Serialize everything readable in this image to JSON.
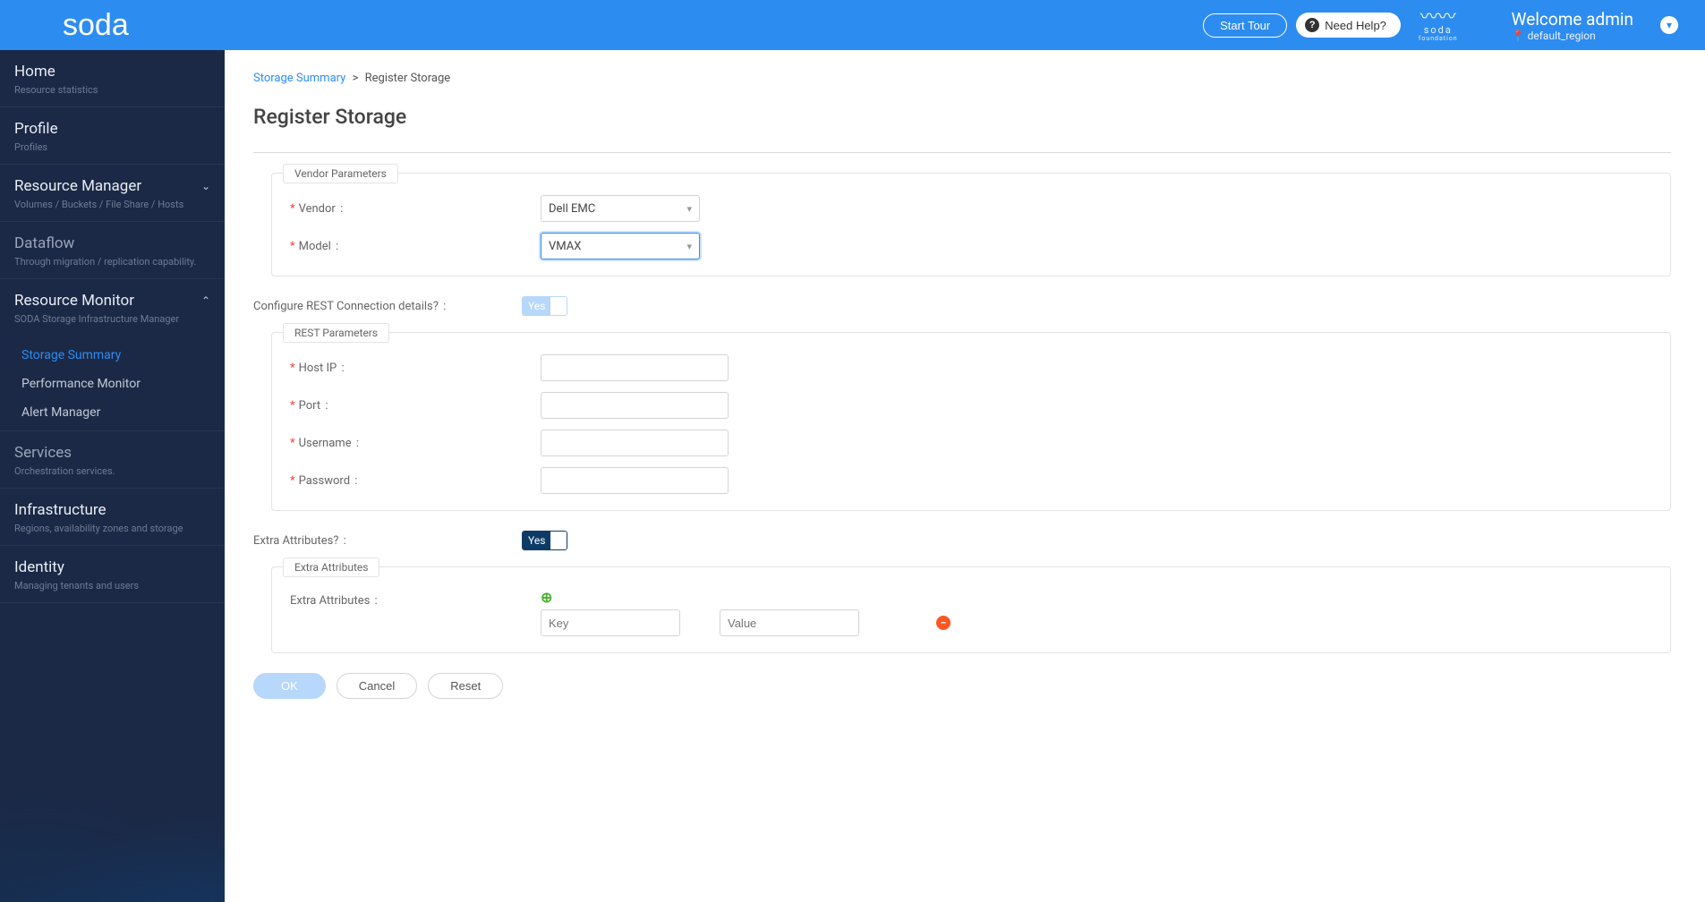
{
  "header": {
    "logo": "soda",
    "start_tour": "Start Tour",
    "need_help": "Need Help?",
    "foundation_top": "soda",
    "foundation_bottom": "foundation",
    "welcome": "Welcome admin",
    "region": "default_region"
  },
  "sidebar": {
    "items": [
      {
        "title": "Home",
        "sub": "Resource statistics"
      },
      {
        "title": "Profile",
        "sub": "Profiles"
      },
      {
        "title": "Resource Manager",
        "sub": "Volumes / Buckets / File Share / Hosts",
        "chevron": "down"
      },
      {
        "title": "Dataflow",
        "sub": "Through migration / replication capability."
      },
      {
        "title": "Resource Monitor",
        "sub": "SODA Storage Infrastructure Manager",
        "chevron": "up",
        "submenu": [
          {
            "label": "Storage Summary",
            "active": true
          },
          {
            "label": "Performance Monitor"
          },
          {
            "label": "Alert Manager"
          }
        ]
      },
      {
        "title": "Services",
        "sub": "Orchestration services."
      },
      {
        "title": "Infrastructure",
        "sub": "Regions, availability zones and storage"
      },
      {
        "title": "Identity",
        "sub": "Managing tenants and users"
      }
    ]
  },
  "breadcrumb": {
    "parent": "Storage Summary",
    "sep": ">",
    "current": "Register Storage"
  },
  "page_title": "Register Storage",
  "vendor_section": {
    "legend": "Vendor Parameters",
    "vendor_label": "Vendor",
    "vendor_value": "Dell EMC",
    "model_label": "Model",
    "model_value": "VMAX"
  },
  "rest_toggle_label": "Configure REST Connection details?",
  "toggle_yes": "Yes",
  "rest_section": {
    "legend": "REST Parameters",
    "host_ip": "Host IP",
    "port": "Port",
    "username": "Username",
    "password": "Password"
  },
  "extra_toggle_label": "Extra Attributes?",
  "extra_section": {
    "legend": "Extra Attributes",
    "row_label": "Extra Attributes",
    "key_placeholder": "Key",
    "value_placeholder": "Value"
  },
  "actions": {
    "ok": "OK",
    "cancel": "Cancel",
    "reset": "Reset"
  }
}
